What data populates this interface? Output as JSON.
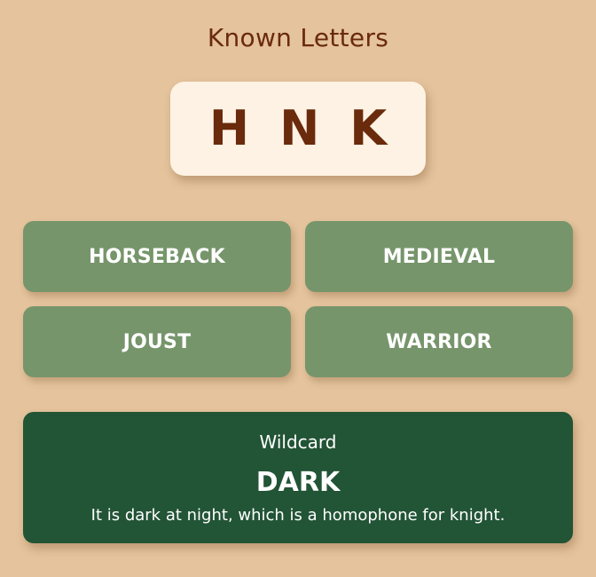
{
  "header": {
    "title": "Known Letters"
  },
  "known_letters": [
    "H",
    "N",
    "K"
  ],
  "clues": [
    "HORSEBACK",
    "MEDIEVAL",
    "JOUST",
    "WARRIOR"
  ],
  "wildcard": {
    "label": "Wildcard",
    "word": "DARK",
    "explanation": "It is dark at night, which is a homophone for knight."
  },
  "colors": {
    "background": "#e4c39d",
    "title_text": "#6a2a0c",
    "letters_box": "#fdf2e3",
    "clue_tile": "#76956b",
    "wildcard_panel": "#225436"
  }
}
